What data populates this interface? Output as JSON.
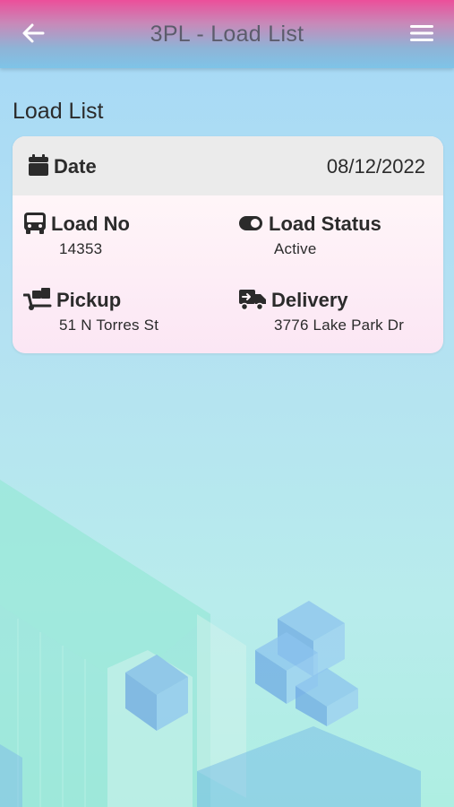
{
  "header": {
    "title": "3PL - Load List",
    "back_icon": "arrow-left-icon",
    "menu_icon": "hamburger-menu-icon"
  },
  "page": {
    "title": "Load List"
  },
  "load_card": {
    "date_label": "Date",
    "date_value": "08/12/2022",
    "load_no_label": "Load No",
    "load_no_value": "14353",
    "status_label": "Load Status",
    "status_value": "Active",
    "pickup_label": "Pickup",
    "pickup_value": "51 N Torres St",
    "delivery_label": "Delivery",
    "delivery_value": "3776 Lake Park Dr"
  },
  "colors": {
    "header_top": "#ec4f9a",
    "header_bottom": "#7ec4e8",
    "background": "#a5d8f6",
    "card_header": "#ebebeb",
    "card_body": "#fbe6f4",
    "text": "#2b2b2b"
  }
}
